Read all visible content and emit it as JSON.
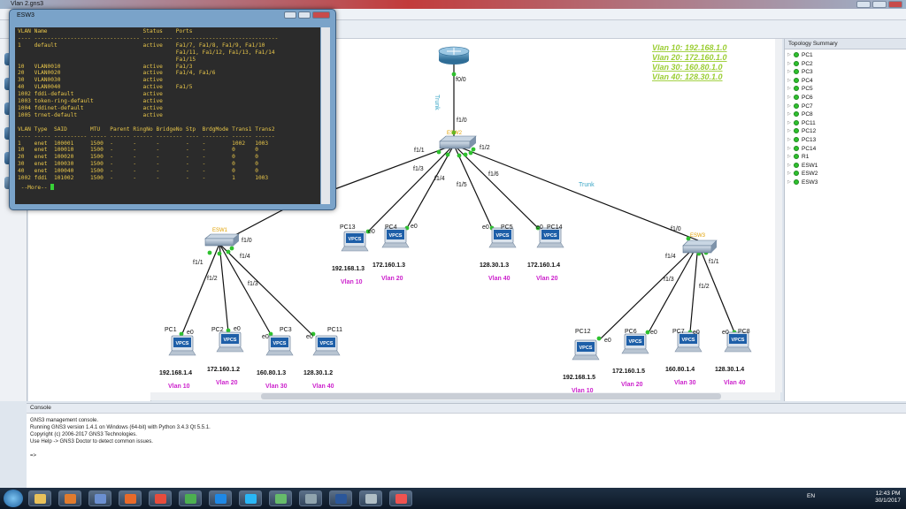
{
  "app": {
    "window_title": "Vlan 2.gns3",
    "colors": {
      "accent": "#3aa6c6",
      "port_up": "#2ec12e",
      "vlan_label": "#cc22cc",
      "note": "#9acd32",
      "terminal_text": "#e8c64a"
    }
  },
  "terminal": {
    "title": "ESW3",
    "lines": [
      "VLAN Name                             Status    Ports",
      "---- -------------------------------- --------- -------------------------------",
      "1    default                          active    Fa1/7, Fa1/8, Fa1/9, Fa1/10",
      "                                                Fa1/11, Fa1/12, Fa1/13, Fa1/14",
      "                                                Fa1/15",
      "10   VLAN0010                         active    Fa1/3",
      "20   VLAN0020                         active    Fa1/4, Fa1/6",
      "30   VLAN0030                         active",
      "40   VLAN0040                         active    Fa1/5",
      "1002 fddi-default                     active",
      "1003 token-ring-default               active",
      "1004 fddinet-default                  active",
      "1005 trnet-default                    active",
      "",
      "VLAN Type  SAID       MTU   Parent RingNo BridgeNo Stp  BrdgMode Trans1 Trans2",
      "---- ----- ---------- ----- ------ ------ -------- ---- -------- ------ ------",
      "1    enet  100001     1500  -      -      -        -    -        1002   1003",
      "10   enet  100010     1500  -      -      -        -    -        0      0",
      "20   enet  100020     1500  -      -      -        -    -        0      0",
      "30   enet  100030     1500  -      -      -        -    -        0      0",
      "40   enet  100040     1500  -      -      -        -    -        0      0",
      "1002 fddi  101002     1500  -      -      -        -    -        1      1003"
    ],
    "more": " --More-- "
  },
  "topology_summary": {
    "title": "Topology Summary",
    "items": [
      "PC1",
      "PC2",
      "PC3",
      "PC4",
      "PC5",
      "PC6",
      "PC7",
      "PC8",
      "PC11",
      "PC12",
      "PC13",
      "PC14",
      "R1",
      "ESW1",
      "ESW2",
      "ESW3"
    ]
  },
  "console": {
    "title": "Console",
    "lines": [
      "GNS3 management console.",
      "Running GNS3 version 1.4.1 on Windows (64-bit) with Python 3.4.3 Qt 5.5.1.",
      "Copyright (c) 2006-2017 GNS3 Technologies.",
      "Use Help -> GNS3 Doctor to detect common issues.",
      "",
      "=>"
    ]
  },
  "notes": [
    "Vlan 10: 192.168.1.0",
    "Vlan 20: 172.160.1.0",
    "Vlan 30: 160.80.1.0",
    "Vlan 40: 128.30.1.0"
  ],
  "topology": {
    "trunk_label": "Trunk",
    "router": {
      "f0": "f0/0"
    },
    "esw2": {
      "name": "ESW2",
      "f10": "f1/0",
      "f11": "f1/1",
      "f12": "f1/2",
      "f13": "f1/3",
      "f14": "f1/4",
      "f15": "f1/5",
      "f16": "f1/6"
    },
    "esw1": {
      "name": "ESW1",
      "f10": "f1/0",
      "f11": "f1/1",
      "f12": "f1/2",
      "f13": "f1/3",
      "f14": "f1/4"
    },
    "esw3": {
      "name": "ESW3",
      "f10": "f1/0",
      "f11": "f1/1",
      "f12": "f1/2",
      "f13": "f1/3",
      "f14": "f1/4"
    },
    "vpcs_label": "VPCS",
    "e0": "e0",
    "pcs": [
      {
        "name": "PC1",
        "ip": "192.168.1.4",
        "vlan": "Vlan 10"
      },
      {
        "name": "PC2",
        "ip": "172.160.1.2",
        "vlan": "Vlan 20"
      },
      {
        "name": "PC3",
        "ip": "160.80.1.3",
        "vlan": "Vlan 30"
      },
      {
        "name": "PC11",
        "ip": "128.30.1.2",
        "vlan": "Vlan 40"
      },
      {
        "name": "PC13",
        "ip": "192.168.1.3",
        "vlan": "Vlan 10"
      },
      {
        "name": "PC4",
        "ip": "172.160.1.3",
        "vlan": "Vlan 20"
      },
      {
        "name": "PC5",
        "ip": "128.30.1.3",
        "vlan": "Vlan 40"
      },
      {
        "name": "PC14",
        "ip": "172.160.1.4",
        "vlan": "Vlan 20"
      },
      {
        "name": "PC12",
        "ip": "192.168.1.5",
        "vlan": "Vlan 10"
      },
      {
        "name": "PC6",
        "ip": "172.160.1.5",
        "vlan": "Vlan 20"
      },
      {
        "name": "PC7",
        "ip": "160.80.1.4",
        "vlan": "Vlan 30"
      },
      {
        "name": "PC8",
        "ip": "128.30.1.4",
        "vlan": "Vlan 40"
      }
    ]
  },
  "taskbar": {
    "lang": "EN",
    "time": "12:43 PM",
    "date": "30/1/2017",
    "apps": [
      "file-explorer-icon",
      "outlook-icon",
      "media-player-icon",
      "firefox-icon",
      "chrome-icon",
      "utorrent-icon",
      "teamviewer-icon",
      "skype-icon",
      "gns3-icon",
      "putty-icon",
      "word-icon",
      "window-icon",
      "gns3-app-icon"
    ]
  }
}
